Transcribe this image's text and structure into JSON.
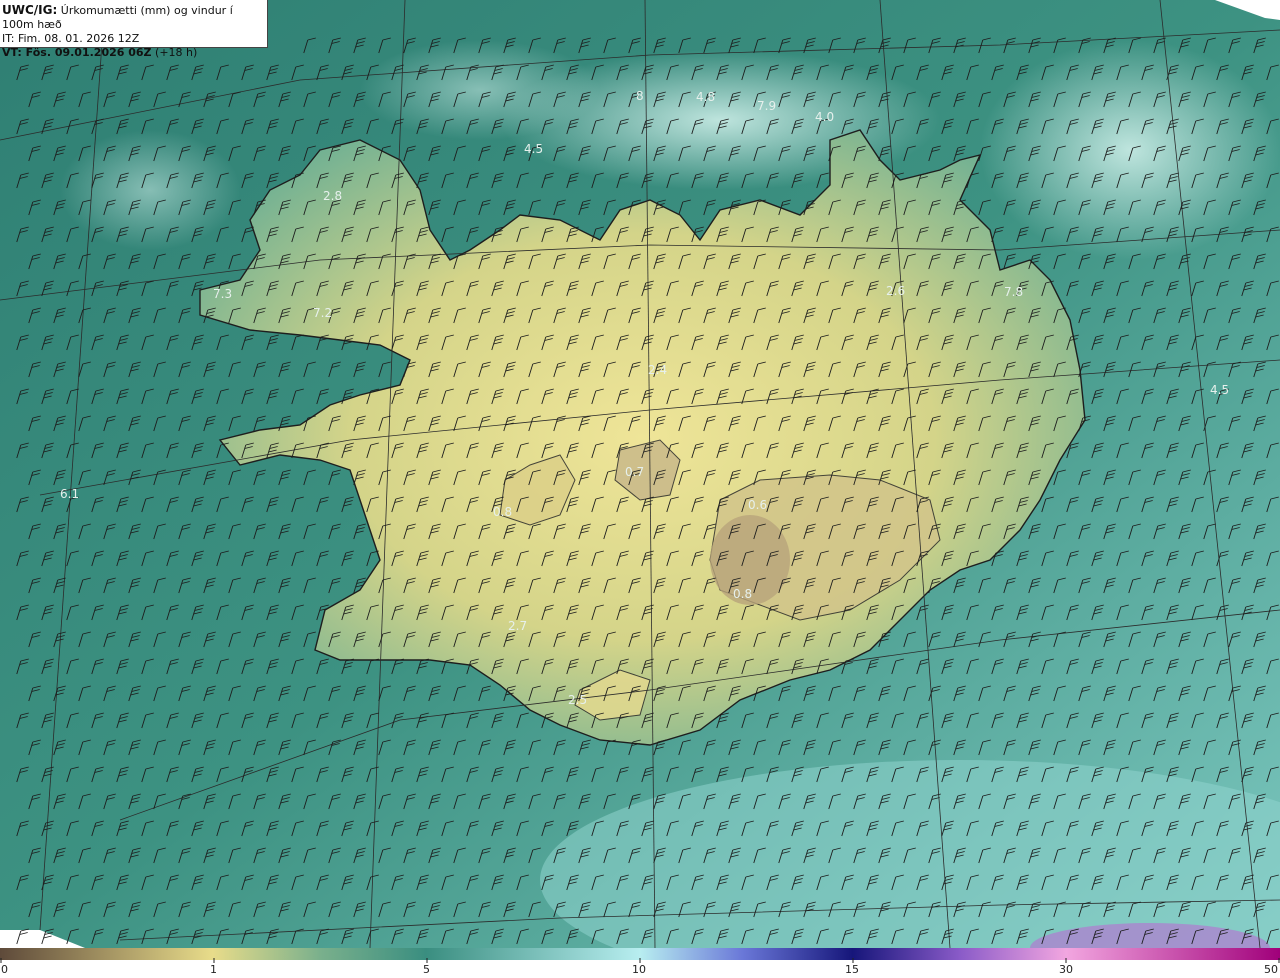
{
  "header": {
    "title_bold": "UWC/IG:",
    "title_rest": " Úrkomumætti (mm) og vindur í 100m hæð",
    "init_time": "IT: Fim. 08. 01. 2026 12Z",
    "valid_bold": "VT: Fös. 09.01.2026 06Z",
    "valid_rest": " (+18 h)"
  },
  "map_labels": [
    "8",
    "4.8",
    "7.9",
    "4.0",
    "4.5",
    "2.8",
    "7.3",
    "7.2",
    "2.6",
    "7.8",
    "4.5",
    "6.1",
    "2.4",
    "0.7",
    "0.6",
    "0.8",
    "2.7",
    "2.5",
    "0.8"
  ],
  "colorbar": {
    "ticks": [
      "0",
      "1",
      "5",
      "10",
      "15",
      "30",
      "50"
    ],
    "colors": [
      "#6b5640",
      "#c2b078",
      "#f0e690",
      "#3a9a8a",
      "#9ee6e6",
      "#1a1a99",
      "#ff99cc",
      "#990066"
    ]
  },
  "palette": {
    "sea": "#3a8c7e",
    "land_dry": "#e8dc8a",
    "land_mid": "#a9c48a",
    "clouds": "#bfe6e0"
  }
}
